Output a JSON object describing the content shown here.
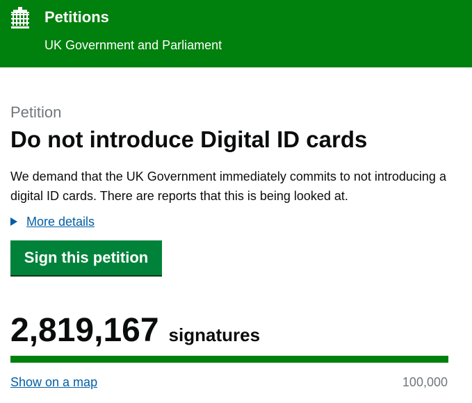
{
  "header": {
    "title": "Petitions",
    "subtitle": "UK Government and Parliament",
    "background_color": "#00800d"
  },
  "petition": {
    "eyebrow": "Petition",
    "title": "Do not introduce Digital ID cards",
    "summary": "We demand that the UK Government immediately commits to not introducing a digital ID cards. There are reports that this is being looked at.",
    "details_link": "More details",
    "sign_button": "Sign this petition",
    "signature_count": "2,819,167",
    "signature_label": "signatures",
    "map_link": "Show on a map",
    "target": "100,000",
    "progress_fraction": 1.0
  },
  "icons": {
    "crest": "portcullis-crest-icon",
    "details": "triangle-right-icon"
  },
  "colors": {
    "link": "#005ea5",
    "button": "#00823b",
    "progress": "#00800d"
  }
}
